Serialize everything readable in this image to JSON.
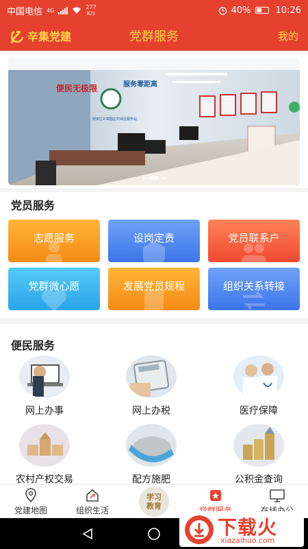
{
  "status_bar": {
    "carrier": "中国电信",
    "network": "4G",
    "speed": "277",
    "speed_unit": "K/s",
    "battery": "40%",
    "time": "10:26"
  },
  "header": {
    "brand": "辛集党建",
    "title": "党群服务",
    "mine": "我的",
    "color": "#e6412f",
    "accent": "#ffd54a"
  },
  "banner": {
    "sign_left": "便民无极限",
    "sign_right": "服务零距离",
    "org": "新家庄乡章图庄村综合服务站",
    "dots": 3,
    "active_dot": 1
  },
  "party_services": {
    "title": "党员服务",
    "tiles": [
      {
        "label": "志愿服务",
        "color": "orange",
        "icon": "person-icon"
      },
      {
        "label": "设岗定责",
        "color": "blue",
        "icon": "badge-icon"
      },
      {
        "label": "党员联系户",
        "color": "red",
        "icon": "people-icon"
      },
      {
        "label": "党群微心愿",
        "color": "sky",
        "icon": "heart-icon"
      },
      {
        "label": "发展党员规程",
        "color": "orange",
        "icon": "document-icon"
      },
      {
        "label": "组织关系转接",
        "color": "blue",
        "icon": "transfer-icon"
      }
    ]
  },
  "civil_services": {
    "title": "便民服务",
    "items": [
      {
        "label": "网上办事",
        "icon": "laptop-icon"
      },
      {
        "label": "网上办税",
        "icon": "calculator-icon"
      },
      {
        "label": "医疗保障",
        "icon": "doctors-icon"
      },
      {
        "label": "农村产权交易",
        "icon": "blocks-icon"
      },
      {
        "label": "配方施肥",
        "icon": "fertilizer-icon"
      },
      {
        "label": "公积金查询",
        "icon": "coins-icon"
      }
    ]
  },
  "tabbar": {
    "items": [
      {
        "label": "党建地图",
        "icon": "map-pin-icon"
      },
      {
        "label": "组织生活",
        "icon": "party-house-icon"
      },
      {
        "label": "学习教育",
        "icon": "study-icon"
      },
      {
        "label": "党群服务",
        "icon": "party-star-icon",
        "active": true
      },
      {
        "label": "在线办公",
        "icon": "monitor-icon"
      }
    ]
  },
  "watermark": {
    "text": "下载火",
    "url": "xiazaihuo.com"
  }
}
